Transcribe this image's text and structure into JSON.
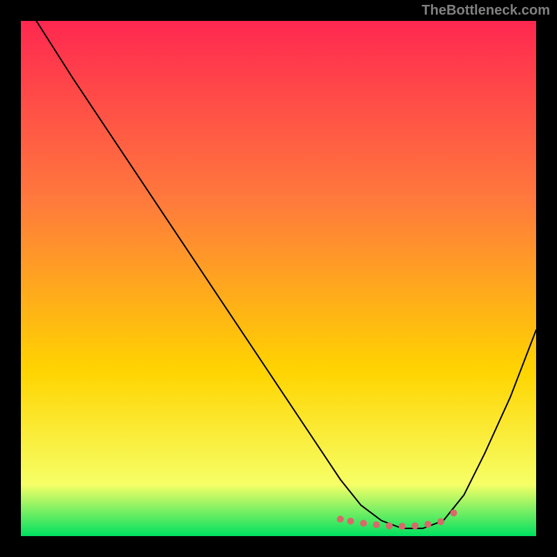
{
  "watermark": "TheBottleneck.com",
  "chart_data": {
    "type": "line",
    "title": "",
    "xlabel": "",
    "ylabel": "",
    "xlim": [
      0,
      100
    ],
    "ylim": [
      0,
      100
    ],
    "grid": false,
    "legend": false,
    "background_gradient": [
      "#ff2850",
      "#ffd400",
      "#00e060"
    ],
    "series": [
      {
        "name": "curve",
        "x": [
          3,
          10,
          20,
          30,
          40,
          50,
          58,
          62,
          66,
          70,
          74,
          78,
          82,
          86,
          90,
          95,
          100
        ],
        "y": [
          100,
          89,
          74,
          59,
          44,
          29,
          17,
          11,
          6,
          3,
          1.5,
          1.5,
          3,
          8,
          16,
          27,
          40
        ]
      }
    ],
    "markers": {
      "name": "bottom-cluster",
      "color": "#d66a6a",
      "points": [
        {
          "x": 62,
          "y": 3.3
        },
        {
          "x": 64,
          "y": 2.9
        },
        {
          "x": 66.5,
          "y": 2.5
        },
        {
          "x": 69,
          "y": 2.2
        },
        {
          "x": 71.5,
          "y": 2.0
        },
        {
          "x": 74,
          "y": 1.9
        },
        {
          "x": 76.5,
          "y": 2.0
        },
        {
          "x": 79,
          "y": 2.3
        },
        {
          "x": 81.5,
          "y": 2.8
        },
        {
          "x": 84,
          "y": 4.5
        }
      ]
    }
  }
}
